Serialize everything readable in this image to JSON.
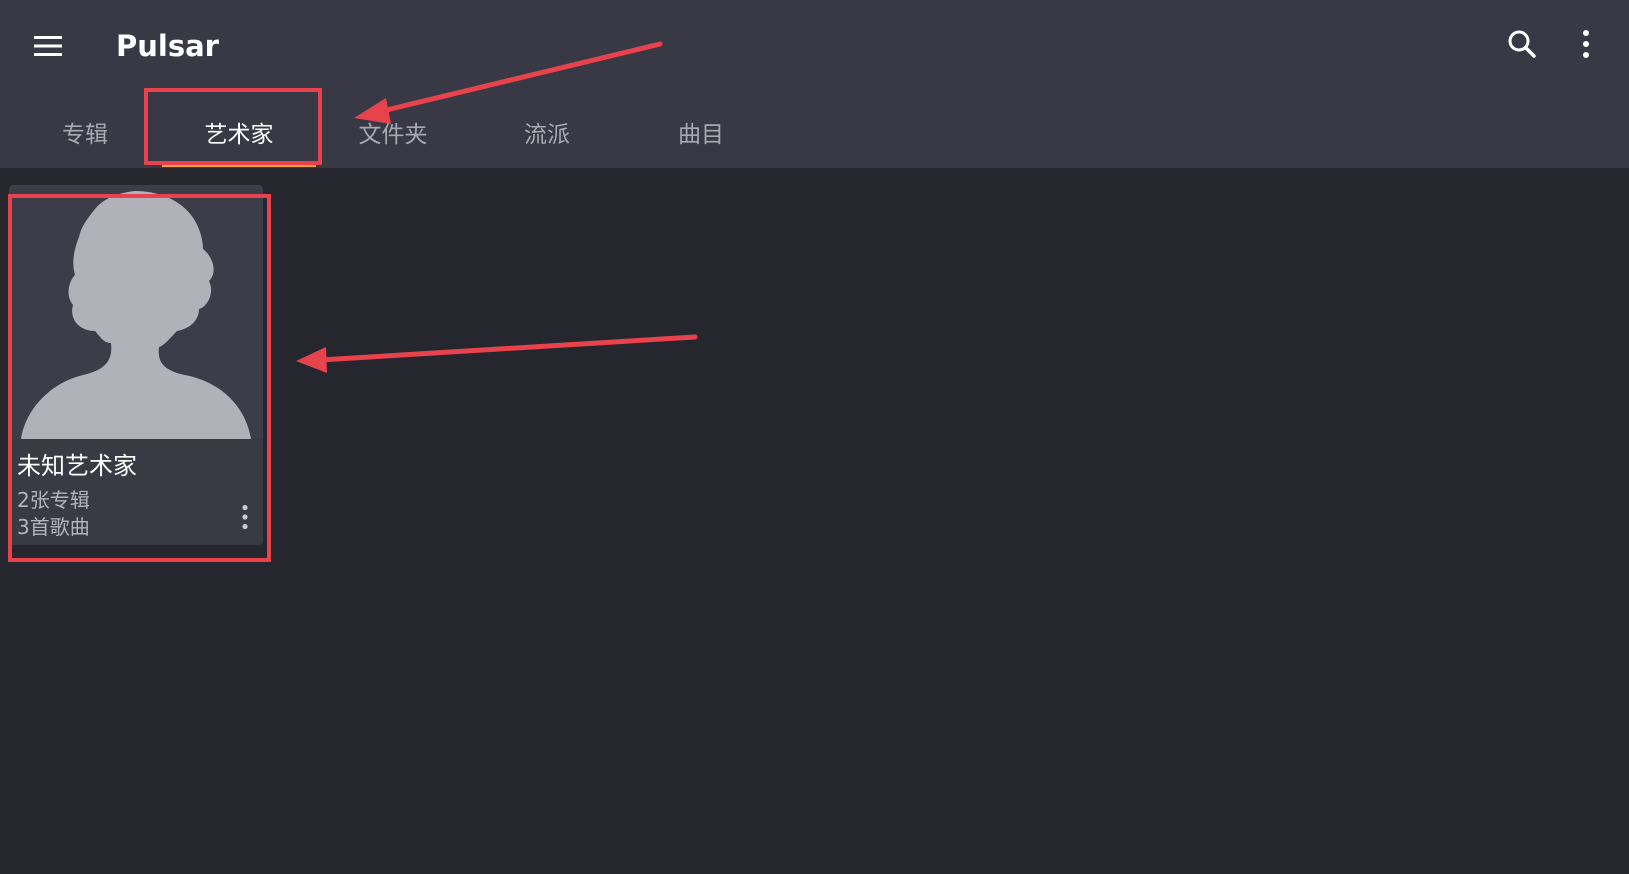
{
  "app": {
    "title": "Pulsar"
  },
  "toolbar": {
    "menu_icon": "hamburger-menu-icon",
    "search_icon": "search-icon",
    "overflow_icon": "vertical-ellipsis-icon"
  },
  "tabs": [
    {
      "label": "专辑",
      "active": false
    },
    {
      "label": "艺术家",
      "active": true
    },
    {
      "label": "文件夹",
      "active": false
    },
    {
      "label": "流派",
      "active": false
    },
    {
      "label": "曲目",
      "active": false
    }
  ],
  "artists": [
    {
      "name": "未知艺术家",
      "albums": "2张专辑",
      "songs": "3首歌曲",
      "image_icon": "person-silhouette-icon",
      "more_icon": "vertical-ellipsis-icon"
    }
  ],
  "colors": {
    "toolbar_bg": "#393946",
    "content_bg": "#26262f",
    "tab_indicator": "#f29a3d",
    "annotation_red": "#e8434d"
  }
}
